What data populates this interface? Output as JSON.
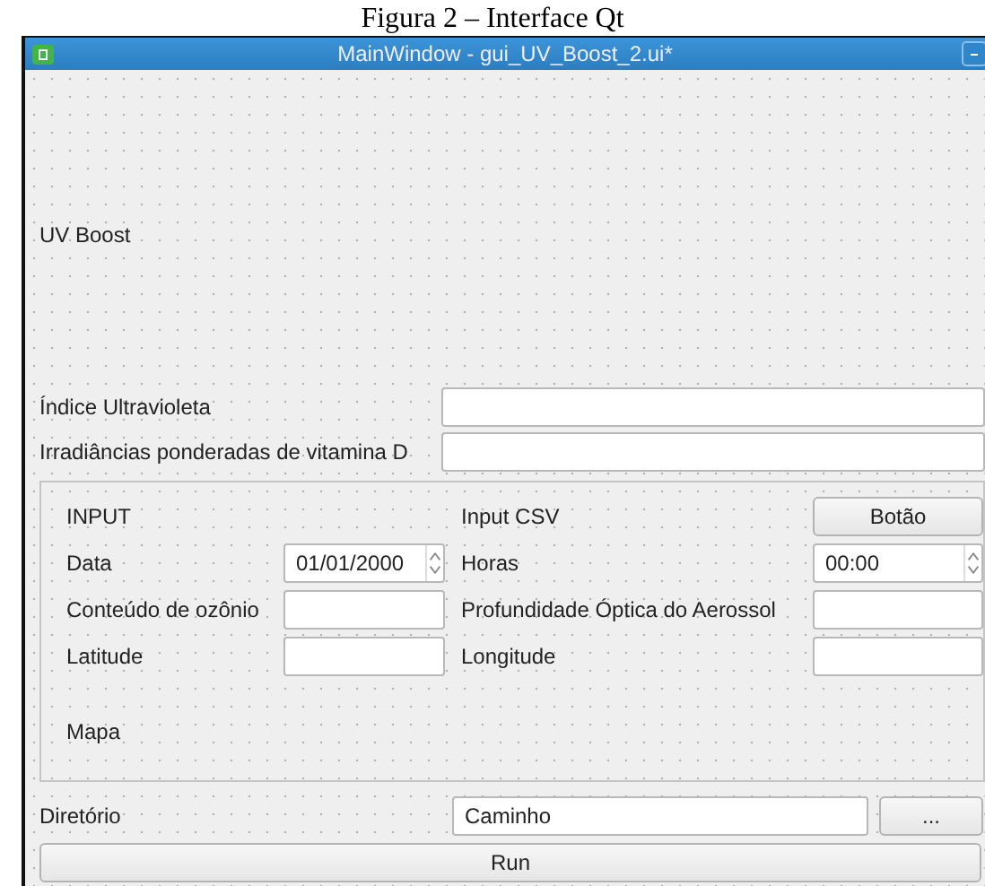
{
  "caption": "Figura 2 – Interface Qt",
  "window": {
    "title": "MainWindow - gui_UV_Boost_2.ui*"
  },
  "heading": "UV Boost",
  "outputs": [
    {
      "label": "Índice Ultravioleta"
    },
    {
      "label": "Irradiâncias ponderadas de vitamina D"
    }
  ],
  "group": {
    "title": "INPUT",
    "csv_label": "Input CSV",
    "csv_button": "Botão",
    "fields": [
      {
        "label": "Data",
        "kind": "spin",
        "value": "01/01/2000"
      },
      {
        "label": "Horas",
        "kind": "spin",
        "value": "00:00"
      },
      {
        "label": "Conteúdo de ozônio",
        "kind": "text"
      },
      {
        "label": "Profundidade Óptica do Aerossol",
        "kind": "text"
      },
      {
        "label": "Latitude",
        "kind": "text"
      },
      {
        "label": "Longitude",
        "kind": "text"
      }
    ],
    "map_label": "Mapa"
  },
  "directory": {
    "label": "Diretório",
    "value": "Caminho",
    "browse_button": "..."
  },
  "run_button": "Run"
}
